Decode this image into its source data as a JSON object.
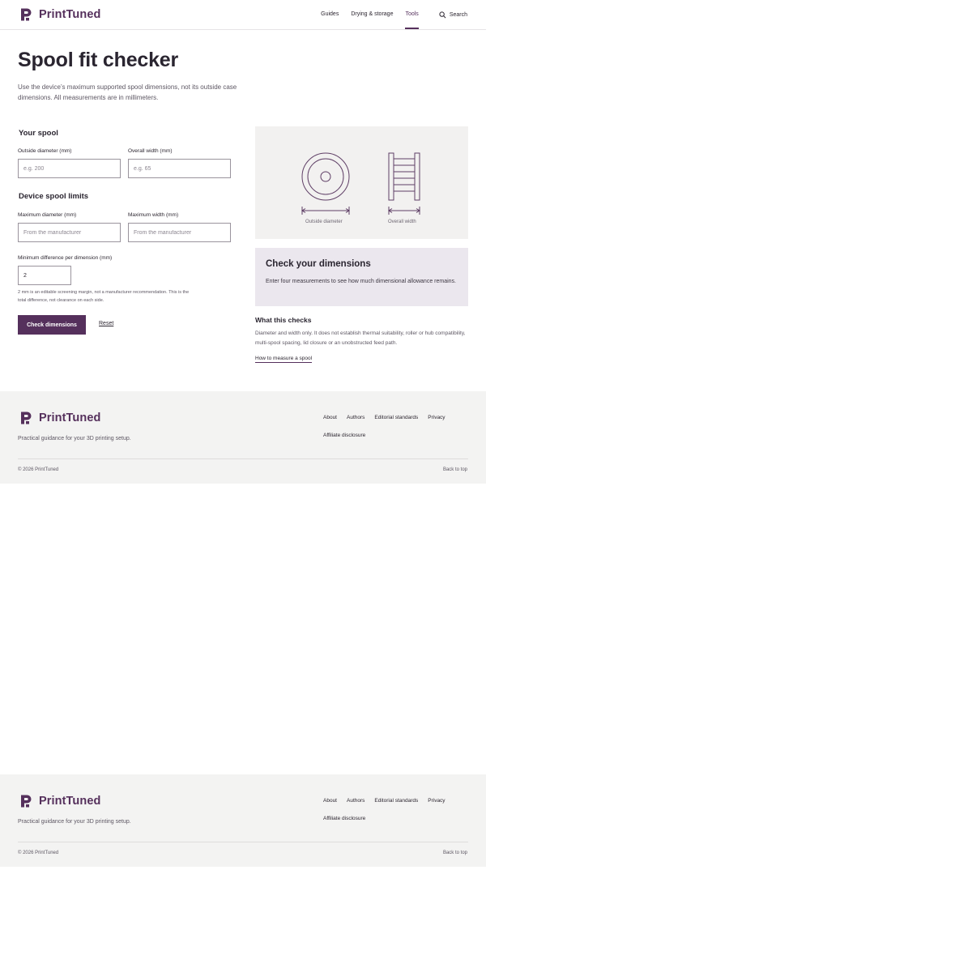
{
  "brand": {
    "name": "PrintTuned",
    "accent": "#55305c"
  },
  "nav": {
    "items": [
      {
        "label": "Guides"
      },
      {
        "label": "Drying & storage"
      },
      {
        "label": "Tools",
        "active": true
      }
    ],
    "search_label": "Search"
  },
  "main": {
    "title": "Spool fit checker",
    "intro": "Use the device’s maximum supported spool dimensions, not its outside case dimensions. All measurements are in millimeters.",
    "your_spool": {
      "heading": "Your spool",
      "diameter_label": "Outside diameter (mm)",
      "diameter_placeholder": "e.g. 200",
      "width_label": "Overall width (mm)",
      "width_placeholder": "e.g. 65"
    },
    "device": {
      "heading": "Device spool limits",
      "max_diameter_label": "Maximum diameter (mm)",
      "max_diameter_placeholder": "From the manufacturer",
      "max_width_label": "Maximum width (mm)",
      "max_width_placeholder": "From the manufacturer"
    },
    "margin": {
      "label": "Minimum difference per dimension (mm)",
      "value": "2",
      "hint": "2 mm is an editable screening margin, not a manufacturer recommendation. This is the total difference, not clearance on each side."
    },
    "actions": {
      "check": "Check dimensions",
      "reset": "Reset"
    },
    "diagram": {
      "diameter_caption": "Outside diameter",
      "width_caption": "Overall width"
    },
    "result": {
      "title": "Check your dimensions",
      "text": "Enter four measurements to see how much dimensional allowance remains."
    },
    "checks": {
      "heading": "What this checks",
      "text": "Diameter and width only. It does not establish thermal suitability, roller or hub compatibility, multi-spool spacing, lid closure or an unobstructed feed path.",
      "link": "How to measure a spool"
    }
  },
  "footer": {
    "tagline": "Practical guidance for your 3D printing setup.",
    "links": [
      "About",
      "Authors",
      "Editorial standards",
      "Privacy",
      "Affiliate disclosure"
    ],
    "copyright": "© 2026 PrintTuned",
    "back_to_top": "Back to top"
  }
}
